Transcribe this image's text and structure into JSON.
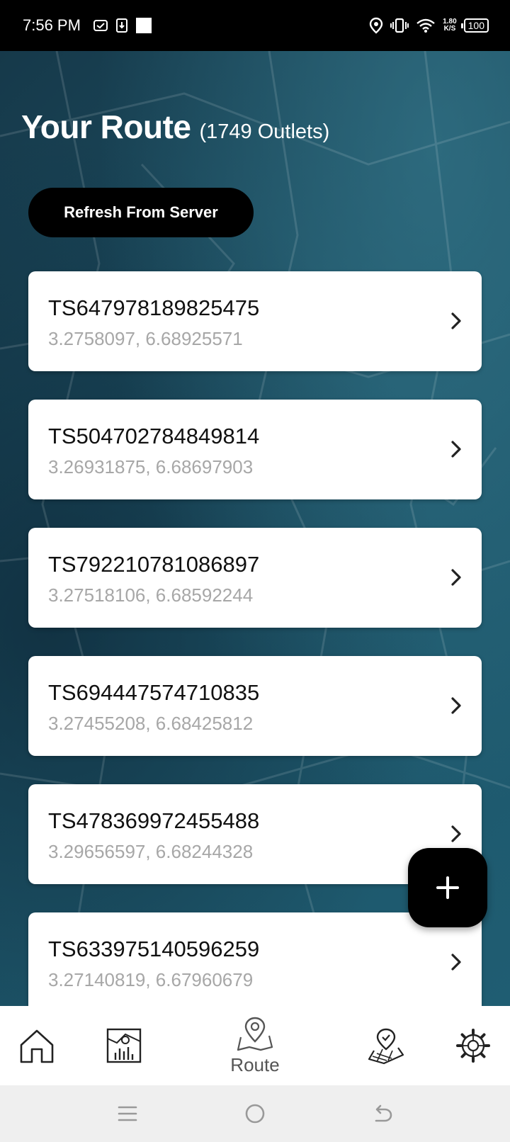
{
  "status_bar": {
    "time": "7:56 PM",
    "net_speed_value": "1.80",
    "net_speed_unit": "K/S",
    "battery": "100",
    "icons": [
      "message-icon",
      "download-icon",
      "square-icon",
      "location-icon",
      "vibrate-icon",
      "wifi-icon",
      "battery-icon"
    ]
  },
  "header": {
    "title": "Your Route",
    "count_label": "(1749 Outlets)"
  },
  "refresh_button": {
    "label": "Refresh From Server"
  },
  "outlets": [
    {
      "id": "TS647978189825475",
      "coords": "3.2758097, 6.68925571"
    },
    {
      "id": "TS504702784849814",
      "coords": "3.26931875, 6.68697903"
    },
    {
      "id": "TS792210781086897",
      "coords": "3.27518106, 6.68592244"
    },
    {
      "id": "TS694447574710835",
      "coords": "3.27455208, 6.68425812"
    },
    {
      "id": "TS478369972455488",
      "coords": "3.29656597, 6.68244328"
    },
    {
      "id": "TS633975140596259",
      "coords": "3.27140819, 6.67960679"
    }
  ],
  "fab": {
    "icon": "plus-icon"
  },
  "bottom_nav": {
    "items": [
      {
        "name": "home",
        "icon": "home-icon",
        "label": ""
      },
      {
        "name": "reports",
        "icon": "map-report-icon",
        "label": ""
      },
      {
        "name": "route",
        "icon": "route-pin-icon",
        "label": "Route",
        "active": true
      },
      {
        "name": "visits",
        "icon": "map-check-icon",
        "label": ""
      },
      {
        "name": "settings",
        "icon": "gear-icon",
        "label": ""
      }
    ]
  },
  "system_nav": {
    "icons": [
      "menu-icon",
      "home-circle-icon",
      "back-icon"
    ]
  },
  "colors": {
    "accent": "#000000",
    "background_gradient": [
      "#16394a",
      "#1f5d72"
    ],
    "coords_text": "#a7a7a7"
  }
}
